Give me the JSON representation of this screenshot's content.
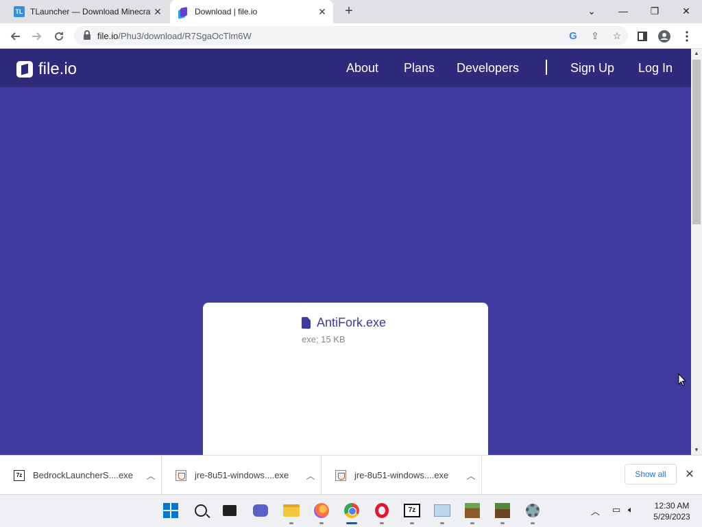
{
  "browser": {
    "tabs": [
      {
        "title": "TLauncher — Download Minecraft",
        "favicon": "TL",
        "active": false
      },
      {
        "title": "Download | file.io",
        "favicon": "file-io-icon",
        "active": true
      }
    ],
    "new_tab": "+",
    "window_controls": {
      "tab_search": "⌄",
      "minimize": "—",
      "restore": "❐",
      "close": "✕"
    },
    "address": {
      "host": "file.io",
      "path": "/Phu3/download/R7SgaOcTlm6W"
    }
  },
  "site": {
    "logo_text": "file.io",
    "nav": {
      "about": "About",
      "plans": "Plans",
      "developers": "Developers",
      "signup": "Sign Up",
      "login": "Log In"
    },
    "bg_color": "#3f3a9e",
    "nav_color": "#2f2a7c"
  },
  "file": {
    "name": "AntiFork.exe",
    "meta": "exe; 15 KB"
  },
  "downloads": {
    "items": [
      {
        "name": "BedrockLauncherS....exe",
        "icon": "7z-icon"
      },
      {
        "name": "jre-8u51-windows....exe",
        "icon": "java-icon"
      },
      {
        "name": "jre-8u51-windows....exe",
        "icon": "java-icon"
      }
    ],
    "show_all": "Show all",
    "close": "✕"
  },
  "taskbar": {
    "apps": [
      "start",
      "search",
      "task-view",
      "meet",
      "file-explorer",
      "firefox",
      "chrome",
      "opera",
      "7-zip",
      "resource-monitor",
      "minecraft",
      "minecraft-launcher",
      "settings"
    ],
    "sevenzip_label": "7z",
    "time": "12:30 AM",
    "date": "5/29/2023"
  }
}
